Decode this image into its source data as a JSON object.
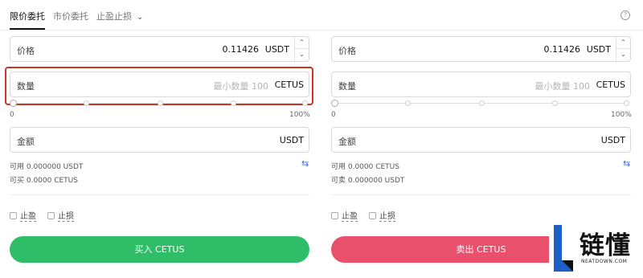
{
  "tabs": {
    "limit": "限价委托",
    "market": "市价委托",
    "tpsl": "止盈止损"
  },
  "buy": {
    "price_label": "价格",
    "price_value": "0.11426",
    "price_unit": "USDT",
    "qty_label": "数量",
    "qty_placeholder": "最小数量 100",
    "qty_unit": "CETUS",
    "slider_min": "0",
    "slider_max": "100%",
    "amount_label": "金额",
    "amount_unit": "USDT",
    "available": "可用 0.000000 USDT",
    "buyable": "可买 0.0000 CETUS",
    "take_profit": "止盈",
    "stop_loss": "止损",
    "button": "买入 CETUS"
  },
  "sell": {
    "price_label": "价格",
    "price_value": "0.11426",
    "price_unit": "USDT",
    "qty_label": "数量",
    "qty_placeholder": "最小数量 100",
    "qty_unit": "CETUS",
    "slider_min": "0",
    "slider_max": "100%",
    "amount_label": "金额",
    "amount_unit": "USDT",
    "available": "可用 0.0000 CETUS",
    "sellable": "可卖 0.000000 USDT",
    "take_profit": "止盈",
    "stop_loss": "止损",
    "button": "卖出 CETUS"
  },
  "watermark": {
    "name": "链懂",
    "domain": "NEATDOWN.COM"
  },
  "colors": {
    "buy": "#2fbd68",
    "sell": "#e8506c",
    "highlight": "#c0392b",
    "link": "#3a6bd8"
  },
  "icons": {
    "help": "help-circle-icon",
    "swap": "swap-arrows-icon",
    "chevron": "chevron-down-icon",
    "logo": "neatdown-logo-icon"
  }
}
